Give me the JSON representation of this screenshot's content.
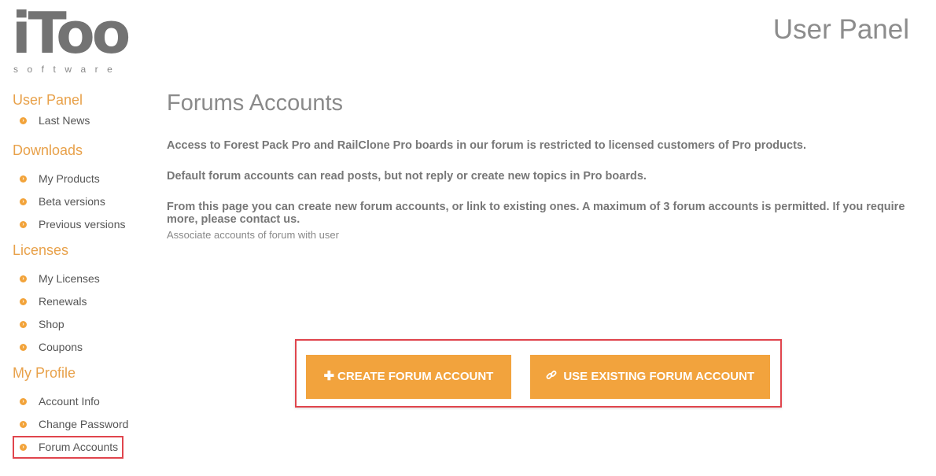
{
  "logo": {
    "main": "iToo",
    "sub": "software"
  },
  "header": {
    "title": "User Panel"
  },
  "sidebar": {
    "sections": [
      {
        "title": "User Panel",
        "items": [
          "Last News"
        ]
      },
      {
        "title": "Downloads",
        "items": [
          "My Products",
          "Beta versions",
          "Previous versions"
        ]
      },
      {
        "title": "Licenses",
        "items": [
          "My Licenses",
          "Renewals",
          "Shop",
          "Coupons"
        ]
      },
      {
        "title": "My Profile",
        "items": [
          "Account Info",
          "Change Password",
          "Forum Accounts"
        ]
      }
    ]
  },
  "main": {
    "title": "Forums Accounts",
    "paragraphs": [
      "Access to Forest Pack Pro and RailClone Pro boards in our forum is restricted to licensed customers of Pro products.",
      "Default forum accounts can read posts, but not reply or create new topics in Pro boards.",
      "From this page you can create new forum accounts, or link to existing ones. A maximum of 3 forum accounts is permitted. If you require more, please contact us."
    ],
    "note": "Associate accounts of forum with user"
  },
  "buttons": {
    "create_icon": "plus-icon",
    "create_label": "CREATE FORUM ACCOUNT",
    "existing_icon": "link-icon",
    "existing_label": "USE EXISTING FORUM ACCOUNT"
  },
  "colors": {
    "accent": "#f2a33d",
    "highlight_border": "#e0454d",
    "section_title": "#e8a14a"
  }
}
